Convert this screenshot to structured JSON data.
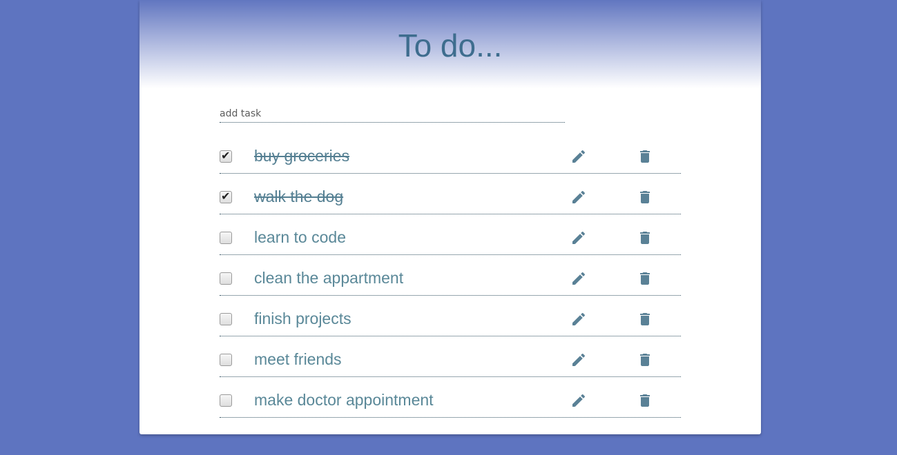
{
  "header": {
    "title": "To do..."
  },
  "add_task": {
    "placeholder": "add task",
    "value": ""
  },
  "tasks": [
    {
      "label": "buy groceries",
      "done": true
    },
    {
      "label": "walk the dog",
      "done": true
    },
    {
      "label": "learn to code",
      "done": false
    },
    {
      "label": "clean the appartment",
      "done": false
    },
    {
      "label": "finish projects",
      "done": false
    },
    {
      "label": "meet friends",
      "done": false
    },
    {
      "label": "make doctor appointment",
      "done": false
    }
  ],
  "icons": {
    "edit": "pencil-icon",
    "delete": "trash-icon",
    "checked": "checkmark-icon"
  },
  "colors": {
    "background": "#5e74c0",
    "title": "#3e6d8e",
    "task_text": "#5a8898",
    "icon": "#5a8196"
  }
}
